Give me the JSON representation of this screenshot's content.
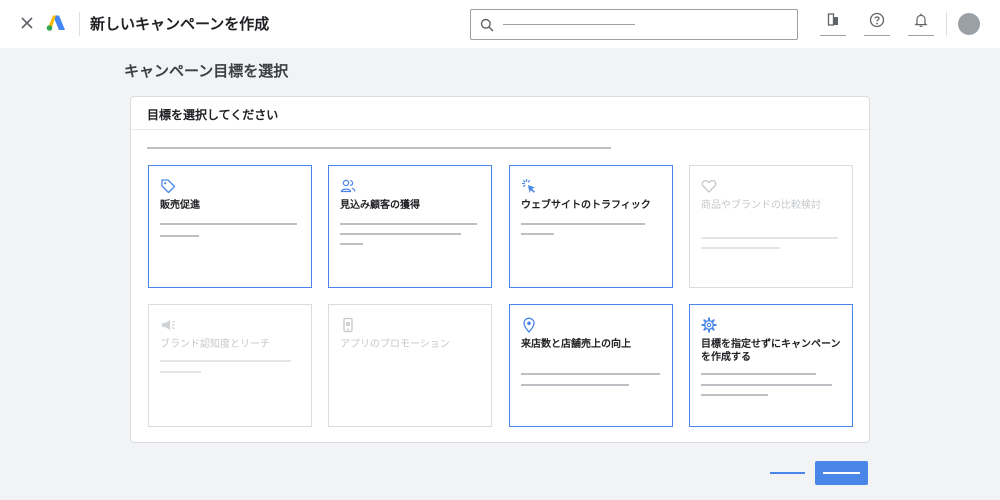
{
  "topbar": {
    "title": "新しいキャンペーンを作成",
    "search_value": "",
    "search_placeholder": ""
  },
  "page": {
    "title": "キャンペーン目標を選択"
  },
  "card": {
    "header": "目標を選択してください"
  },
  "objectives": [
    {
      "label": "販売促進",
      "icon": "tag-icon",
      "enabled": true
    },
    {
      "label": "見込み顧客の獲得",
      "icon": "people-icon",
      "enabled": true
    },
    {
      "label": "ウェブサイトのトラフィック",
      "icon": "cursor-click-icon",
      "enabled": true
    },
    {
      "label": "商品やブランドの比較検討",
      "icon": "heart-icon",
      "enabled": false
    },
    {
      "label": "ブランド認知度とリーチ",
      "icon": "megaphone-icon",
      "enabled": false
    },
    {
      "label": "アプリのプロモーション",
      "icon": "smartphone-icon",
      "enabled": false
    },
    {
      "label": "来店数と店舗売上の向上",
      "icon": "location-pin-icon",
      "enabled": true
    },
    {
      "label": "目標を指定せずにキャンペーンを作成する",
      "icon": "gear-icon",
      "enabled": true
    }
  ],
  "colors": {
    "accent": "#4a86e8",
    "border_disabled": "#dadce0",
    "placeholder_line": "#bdc1c6",
    "background": "#f1f3f4"
  }
}
